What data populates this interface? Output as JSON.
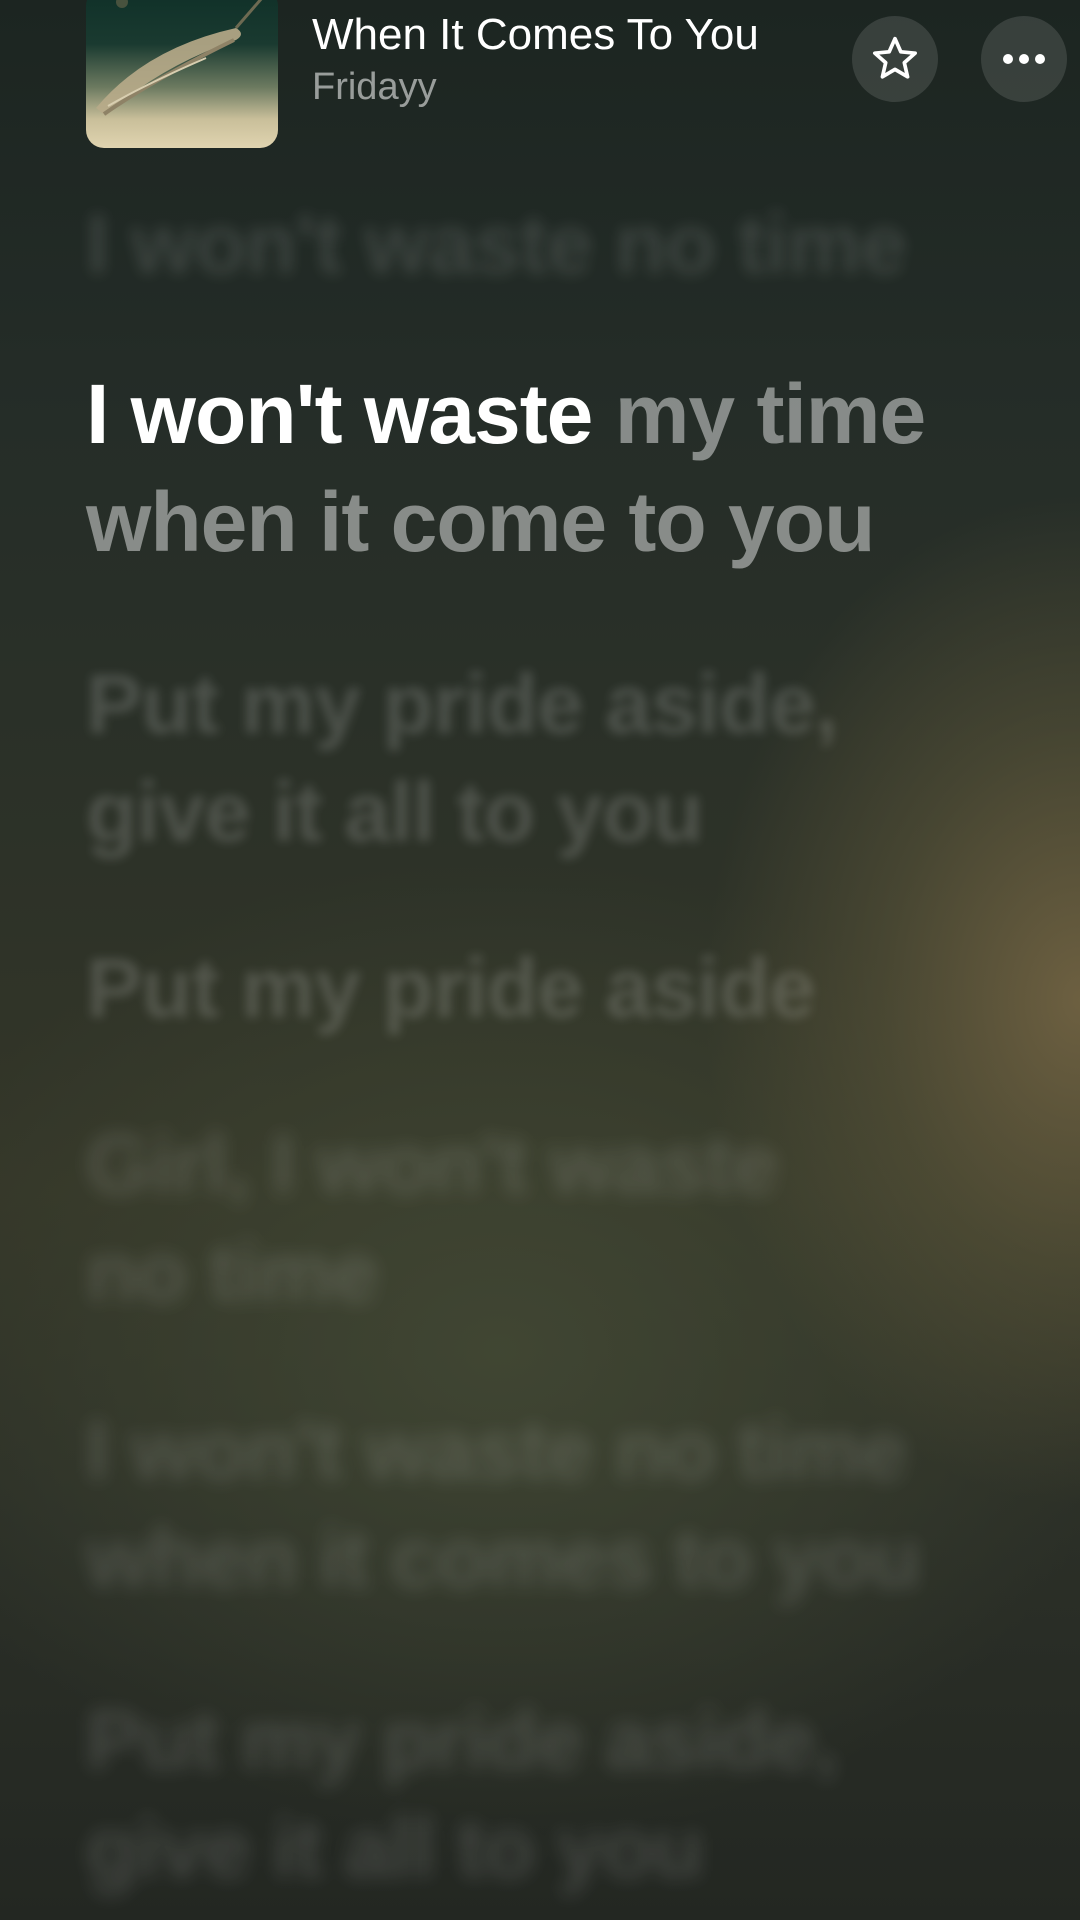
{
  "now_playing": {
    "title": "When It Comes To You",
    "artist": "Fridayy"
  },
  "actions": {
    "favorite_icon": "star-icon",
    "more_icon": "more-horizontal-icon"
  },
  "lyrics": {
    "previous_line": "I won't waste no time",
    "current": {
      "sung": "I won't waste",
      "unsung_line1": " my time",
      "line2": "when it come to you"
    },
    "upcoming": [
      {
        "line1": "Put my pride aside,",
        "line2": "give it all to you"
      },
      {
        "line1": "Put my pride aside"
      },
      {
        "line1": "Girl, I won't waste",
        "line2": "no time"
      },
      {
        "line1": "I won't waste no time",
        "line2": "when it comes to you"
      },
      {
        "line1": "Put my pride aside,",
        "line2": "give it all to you"
      }
    ]
  },
  "colors": {
    "active_text": "#ffffff",
    "background_top": "#1c2521",
    "background_warm": "#706242"
  }
}
